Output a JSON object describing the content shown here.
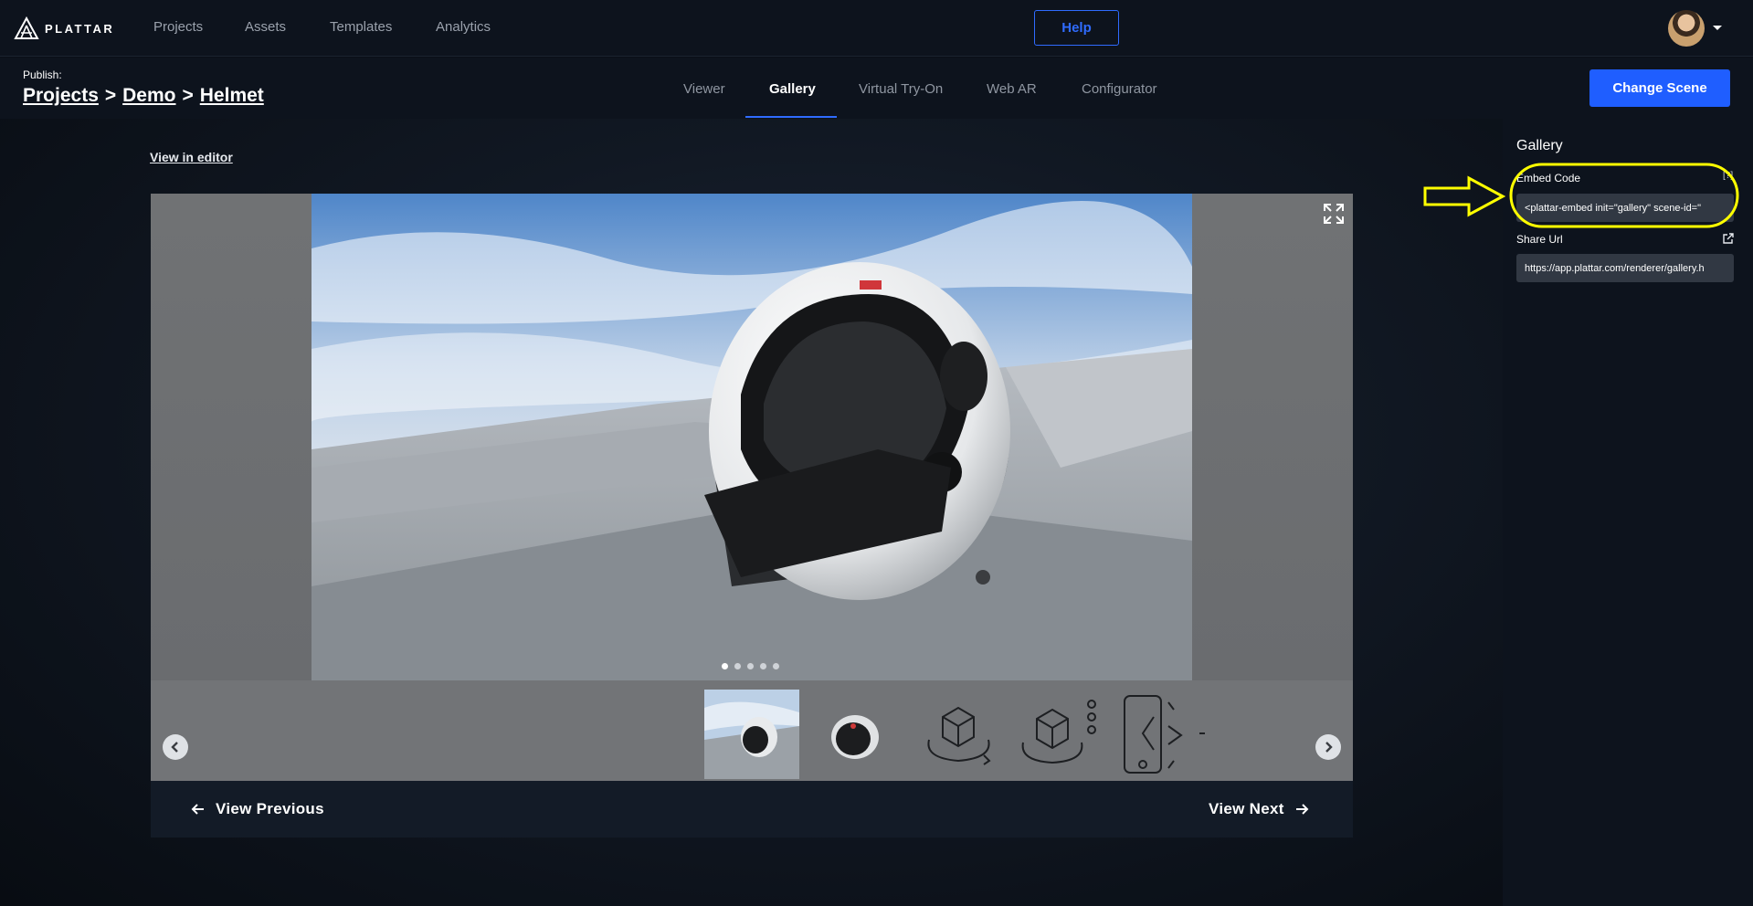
{
  "app": {
    "brand": "PLATTAR"
  },
  "nav": {
    "items": [
      {
        "label": "Projects"
      },
      {
        "label": "Assets"
      },
      {
        "label": "Templates"
      },
      {
        "label": "Analytics"
      }
    ],
    "help_label": "Help"
  },
  "subheader": {
    "publish_label": "Publish:",
    "breadcrumb": [
      {
        "label": "Projects"
      },
      {
        "label": "Demo"
      },
      {
        "label": "Helmet"
      }
    ],
    "separator": ">",
    "tabs": [
      {
        "label": "Viewer"
      },
      {
        "label": "Gallery"
      },
      {
        "label": "Virtual Try-On"
      },
      {
        "label": "Web AR"
      },
      {
        "label": "Configurator"
      }
    ],
    "active_tab": "Gallery",
    "change_scene_label": "Change Scene"
  },
  "main": {
    "view_in_editor": "View in editor",
    "slide_count": 5,
    "active_slide": 1,
    "thumbnails": [
      {
        "icon": "photo-thumbnail"
      },
      {
        "icon": "helmet-thumbnail"
      },
      {
        "icon": "3d-rotate-icon"
      },
      {
        "icon": "3d-rotate-dots-icon"
      },
      {
        "icon": "phone-ar-icon"
      }
    ],
    "view_previous": "View Previous",
    "view_next": "View Next"
  },
  "panel": {
    "title": "Gallery",
    "embed_code_label": "Embed Code",
    "embed_code_help": "[?]",
    "embed_code_value": "<plattar-embed init=\"gallery\" scene-id=\"",
    "share_url_label": "Share Url",
    "share_url_value": "https://app.plattar.com/renderer/gallery.h"
  },
  "colors": {
    "accent": "#1f5eff",
    "annotation": "#ffff00",
    "background": "#0d131d"
  }
}
